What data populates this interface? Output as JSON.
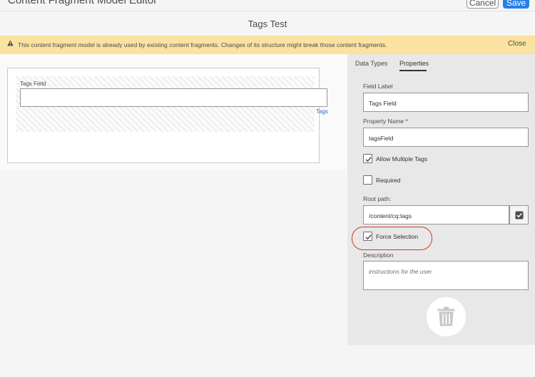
{
  "header": {
    "app_title": "Content Fragment Model Editor",
    "cancel_label": "Cancel",
    "save_label": "Save"
  },
  "page": {
    "title": "Tags Test"
  },
  "alert": {
    "icon": "warning-icon",
    "message": "This content fragment model is already used by existing content fragments. Changes of its structure might break those content fragments.",
    "close_label": "Close"
  },
  "canvas": {
    "field_label": "Tags Field",
    "field_type": "Tags"
  },
  "panel": {
    "tabs": [
      {
        "label": "Data Types",
        "active": false
      },
      {
        "label": "Properties",
        "active": true
      }
    ],
    "field_label": {
      "label": "Field Label",
      "value": "Tags Field"
    },
    "property_name": {
      "label": "Property Name *",
      "value": "tagsField"
    },
    "allow_multiple": {
      "label": "Allow Multiple Tags",
      "checked": true
    },
    "required": {
      "label": "Required",
      "checked": false
    },
    "root_path": {
      "label": "Root path:",
      "value": "/content/cq:tags",
      "picker_icon": "checkbox-picker-icon"
    },
    "force_selection": {
      "label": "Force Selection",
      "checked": true
    },
    "description": {
      "label": "Description",
      "placeholder": "instructions for the user"
    },
    "delete_icon": "trash-icon"
  },
  "colors": {
    "accent": "#2680eb",
    "alert_bg": "#fae2a0",
    "annotation": "#d13b1e",
    "link": "#2d6cc0"
  }
}
